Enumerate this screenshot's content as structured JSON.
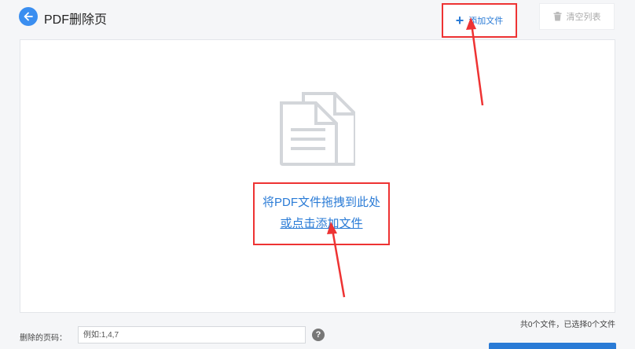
{
  "header": {
    "title": "PDF删除页",
    "back_icon": "arrow-left-icon",
    "add_file_label": "添加文件",
    "clear_list_label": "清空列表",
    "accent_color": "#3a8ef0",
    "highlight_color": "#ee3333"
  },
  "drop_zone": {
    "icon": "document-stack-icon",
    "line1": "将PDF文件拖拽到此处",
    "line2": "或点击添加文件"
  },
  "status": {
    "file_count": "共0个文件，已选择0个文件"
  },
  "pages": {
    "label": "删除的页码：",
    "placeholder": "例如:1,4,7",
    "help_icon": "question-icon"
  }
}
